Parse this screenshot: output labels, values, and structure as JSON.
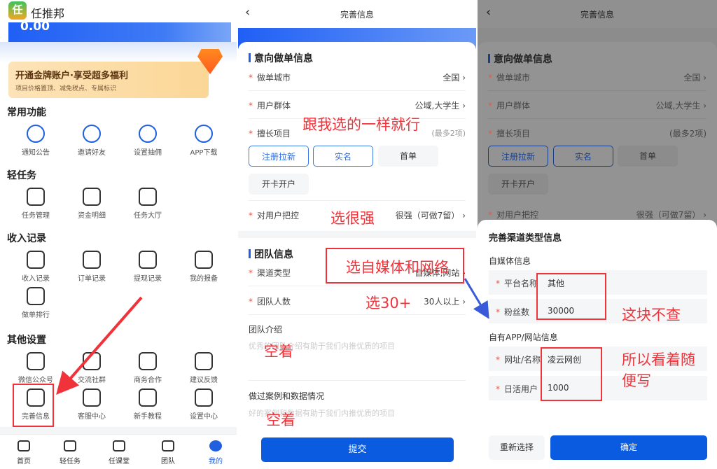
{
  "left": {
    "app_title": "任推邦",
    "balance": "0.00",
    "banner": {
      "title": "开通金牌账户·享受超多福利",
      "subtitle": "项目价格置顶、减免税点、专属标识"
    },
    "sections": [
      {
        "title": "常用功能",
        "items": [
          {
            "label": "通知公告",
            "icon": "megaphone-icon"
          },
          {
            "label": "邀请好友",
            "icon": "add-user-icon"
          },
          {
            "label": "设置抽佣",
            "icon": "money-bag-icon"
          },
          {
            "label": "APP下载",
            "icon": "cloud-download-icon"
          }
        ]
      },
      {
        "title": "轻任务",
        "items": [
          {
            "label": "任务管理",
            "icon": "clipboard-check-icon"
          },
          {
            "label": "资金明细",
            "icon": "fund-search-icon"
          },
          {
            "label": "任务大厅",
            "icon": "grid-icon"
          }
        ]
      },
      {
        "title": "收入记录",
        "items": [
          {
            "label": "收入记录",
            "icon": "yuan-refresh-icon"
          },
          {
            "label": "订单记录",
            "icon": "order-icon"
          },
          {
            "label": "提现记录",
            "icon": "withdraw-icon"
          },
          {
            "label": "我的报备",
            "icon": "id-card-icon"
          },
          {
            "label": "做单排行",
            "icon": "trophy-icon"
          }
        ]
      },
      {
        "title": "其他设置",
        "items": [
          {
            "label": "微信公众号",
            "icon": "wechat-icon"
          },
          {
            "label": "交流社群",
            "icon": "chat-icon"
          },
          {
            "label": "商务合作",
            "icon": "briefcase-icon"
          },
          {
            "label": "建议反馈",
            "icon": "feedback-icon"
          },
          {
            "label": "完善信息",
            "icon": "user-icon"
          },
          {
            "label": "客服中心",
            "icon": "headset-icon"
          },
          {
            "label": "新手教程",
            "icon": "book-icon"
          },
          {
            "label": "设置中心",
            "icon": "hexagon-settings-icon"
          }
        ]
      }
    ],
    "nav": [
      {
        "label": "首页"
      },
      {
        "label": "轻任务"
      },
      {
        "label": "任课堂"
      },
      {
        "label": "团队"
      },
      {
        "label": "我的",
        "active": true
      }
    ]
  },
  "form": {
    "title": "完善信息",
    "section1": "意向做单信息",
    "city": {
      "label": "做单城市",
      "value": "全国"
    },
    "group": {
      "label": "用户群体",
      "value": "公域,大学生"
    },
    "skills": {
      "label": "擅长项目",
      "hint": "(最多2项)",
      "chips": [
        {
          "label": "注册拉新",
          "selected": true
        },
        {
          "label": "实名",
          "selected": true
        },
        {
          "label": "首单",
          "selected": false
        },
        {
          "label": "开卡开户",
          "selected": false
        }
      ]
    },
    "control": {
      "label": "对用户把控",
      "value": "很强（可做7留）"
    },
    "section2": "团队信息",
    "channel": {
      "label": "渠道类型",
      "value": "自媒体,网站"
    },
    "size": {
      "label": "团队人数",
      "value": "30人以上"
    },
    "intro": {
      "label": "团队介绍",
      "placeholder": "优秀的团队介绍有助于我们内推优质的项目"
    },
    "cases": {
      "label": "做过案例和数据情况",
      "placeholder": "好的案例和数据有助于我们内推优质的项目"
    },
    "submit": "提交"
  },
  "modal": {
    "title": "完善渠道类型信息",
    "media_heading": "自媒体信息",
    "platform": {
      "label": "平台名称",
      "value": "其他"
    },
    "fans": {
      "label": "粉丝数",
      "value": "30000"
    },
    "app_heading": "自有APP/网站信息",
    "site": {
      "label": "网址/名称",
      "value": "凌云网创"
    },
    "dau": {
      "label": "日活用户",
      "value": "1000"
    },
    "reset": "重新选择",
    "confirm": "确定"
  },
  "annotations": {
    "a1": "跟我选的一样就行",
    "a2": "选很强",
    "a3": "选自媒体和网络",
    "a4": "选30+",
    "a5": "空着",
    "a6": "空着",
    "a7": "这块不查",
    "a8": "所以看着随",
    "a9": "便写"
  },
  "colors": {
    "accent": "#1f5fe0",
    "annotation": "#f0333a"
  }
}
